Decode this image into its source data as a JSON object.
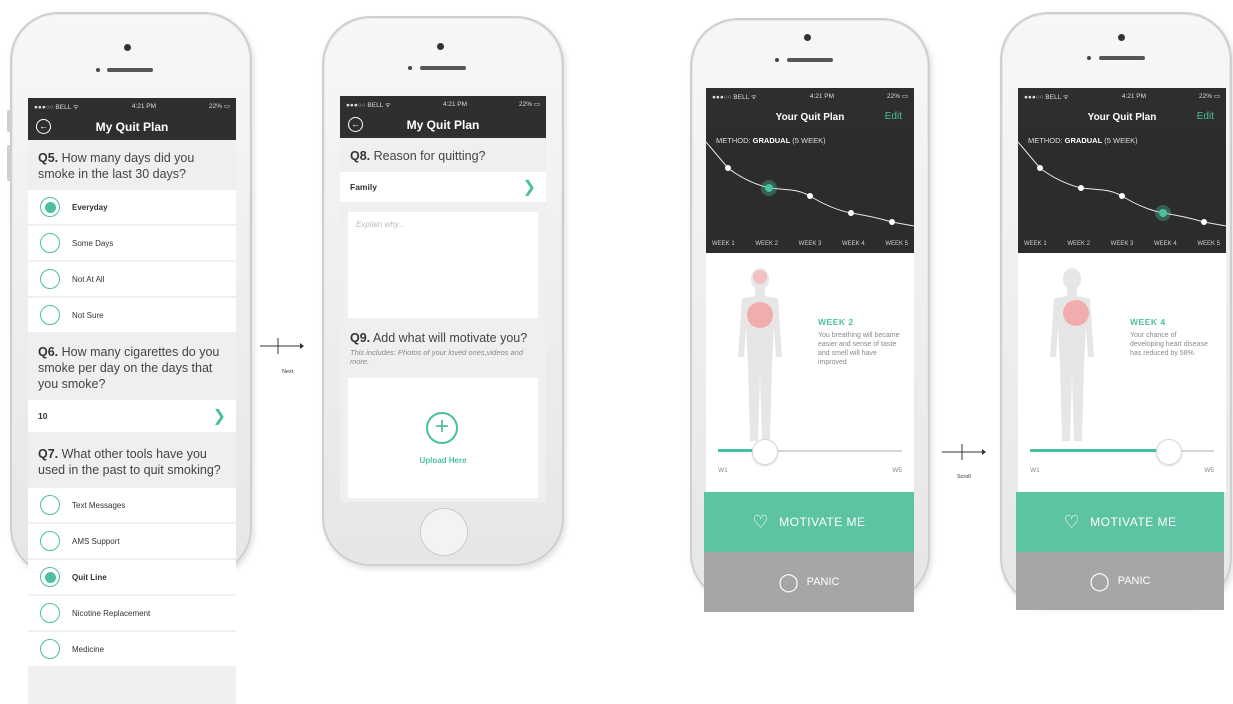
{
  "colors": {
    "accent": "#4cbfa0",
    "dark": "#2f2f2f",
    "motivate": "#5cc3a3",
    "panic": "#a6a6a6"
  },
  "status": {
    "carrier": "●●●○○ BELL ᯤ",
    "time": "4:21 PM",
    "battery": "22%"
  },
  "screen1": {
    "title": "My Quit Plan",
    "q5_num": "Q5.",
    "q5_text": " How many days did you smoke in the last 30 days?",
    "q5_options": [
      "Everyday",
      "Some Days",
      "Not At All",
      "Not Sure"
    ],
    "q5_selected": 0,
    "q6_num": "Q6.",
    "q6_text": " How many cigarettes do you smoke per day on the days that you smoke?",
    "q6_value": "10",
    "q7_num": "Q7.",
    "q7_text": " What other tools have you used in the past to quit smoking?",
    "q7_options": [
      "Text Messages",
      "AMS Support",
      "Quit Line",
      "Nicotine Replacement",
      "Medicine"
    ],
    "q7_selected": 2
  },
  "arrow1_label": "Next",
  "screen2": {
    "title": "My Quit Plan",
    "q8_num": "Q8.",
    "q8_text": " Reason for quitting?",
    "q8_value": "Family",
    "explain_placeholder": "Explain why...",
    "q9_num": "Q9.",
    "q9_text": " Add what will motivate you?",
    "q9_hint": "This includes: Photos of your loved ones,videos and more.",
    "upload_label": "Upload Here"
  },
  "arrow2_label": "Scroll",
  "screen3": {
    "title": "Your Quit Plan",
    "edit": "Edit",
    "method_prefix": "METHOD: ",
    "method_name": "GRADUAL",
    "method_suffix": " (5 WEEK)",
    "weeks": [
      "WEEK 1",
      "WEEK 2",
      "WEEK 3",
      "WEEK 4",
      "WEEK 5"
    ],
    "active_week_index": 1,
    "week_title": "WEEK 2",
    "week_desc": "You breathing will became easier and sense of taste and smell will have improved",
    "slider_min": "W1",
    "slider_max": "W5",
    "slider_fraction": 0.25,
    "motivate": "MOTIVATE ME",
    "panic": "PANIC"
  },
  "screen4": {
    "title": "Your Quit Plan",
    "edit": "Edit",
    "method_prefix": "METHOD: ",
    "method_name": "GRADUAL",
    "method_suffix": " (5 WEEK)",
    "weeks": [
      "WEEK 1",
      "WEEK 2",
      "WEEK 3",
      "WEEK 4",
      "WEEK 5"
    ],
    "active_week_index": 3,
    "week_title": "WEEK 4",
    "week_desc": "Your chance of developing heart disease has reduced by 58%",
    "slider_min": "W1",
    "slider_max": "W5",
    "slider_fraction": 0.75,
    "motivate": "MOTIVATE ME",
    "panic": "PANIC"
  }
}
